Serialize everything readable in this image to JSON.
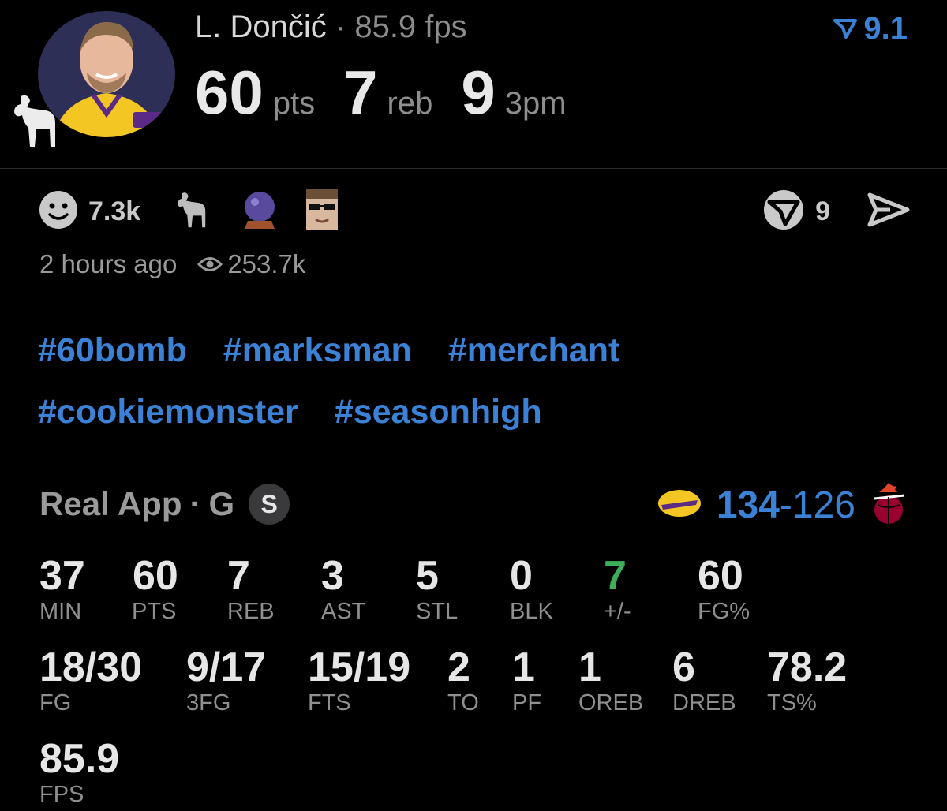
{
  "header": {
    "player_name": "L. Dončić",
    "separator": "·",
    "fps_text": "85.9 fps",
    "rating": "9.1",
    "main_stats": [
      {
        "value": "60",
        "unit": "pts"
      },
      {
        "value": "7",
        "unit": "reb"
      },
      {
        "value": "9",
        "unit": "3pm"
      }
    ]
  },
  "reactions": {
    "smile_count": "7.3k",
    "tag_count": "9",
    "posted": "2 hours ago",
    "views": "253.7k"
  },
  "hashtags": [
    "#60bomb",
    "#marksman",
    "#merchant",
    "#cookiemonster",
    "#seasonhigh"
  ],
  "game": {
    "source": "Real App",
    "separator": "·",
    "position": "G",
    "badge": "S",
    "home_score": "134",
    "dash": "-",
    "away_score": "126"
  },
  "stats_row1": [
    {
      "value": "37",
      "label": "MIN"
    },
    {
      "value": "60",
      "label": "PTS"
    },
    {
      "value": "7",
      "label": "REB"
    },
    {
      "value": "3",
      "label": "AST"
    },
    {
      "value": "5",
      "label": "STL"
    },
    {
      "value": "0",
      "label": "BLK"
    },
    {
      "value": "7",
      "label": "+/-"
    },
    {
      "value": "60",
      "label": "FG%"
    }
  ],
  "stats_row2": [
    {
      "value": "18/30",
      "label": "FG"
    },
    {
      "value": "9/17",
      "label": "3FG"
    },
    {
      "value": "15/19",
      "label": "FTS"
    },
    {
      "value": "2",
      "label": "TO"
    },
    {
      "value": "1",
      "label": "PF"
    },
    {
      "value": "1",
      "label": "OREB"
    },
    {
      "value": "6",
      "label": "DREB"
    },
    {
      "value": "78.2",
      "label": "TS%"
    }
  ],
  "stats_row3": [
    {
      "value": "85.9",
      "label": "FPS"
    }
  ],
  "colors": {
    "accent": "#3b82d6",
    "positive": "#3fae5a",
    "background": "#000000"
  },
  "icons": [
    "goat-icon",
    "rating-arrow-icon",
    "smile-icon",
    "crystal-ball-icon",
    "sunglasses-avatar-icon",
    "tag-circle-icon",
    "send-icon",
    "eye-icon",
    "lakers-logo-icon",
    "heat-logo-icon"
  ]
}
